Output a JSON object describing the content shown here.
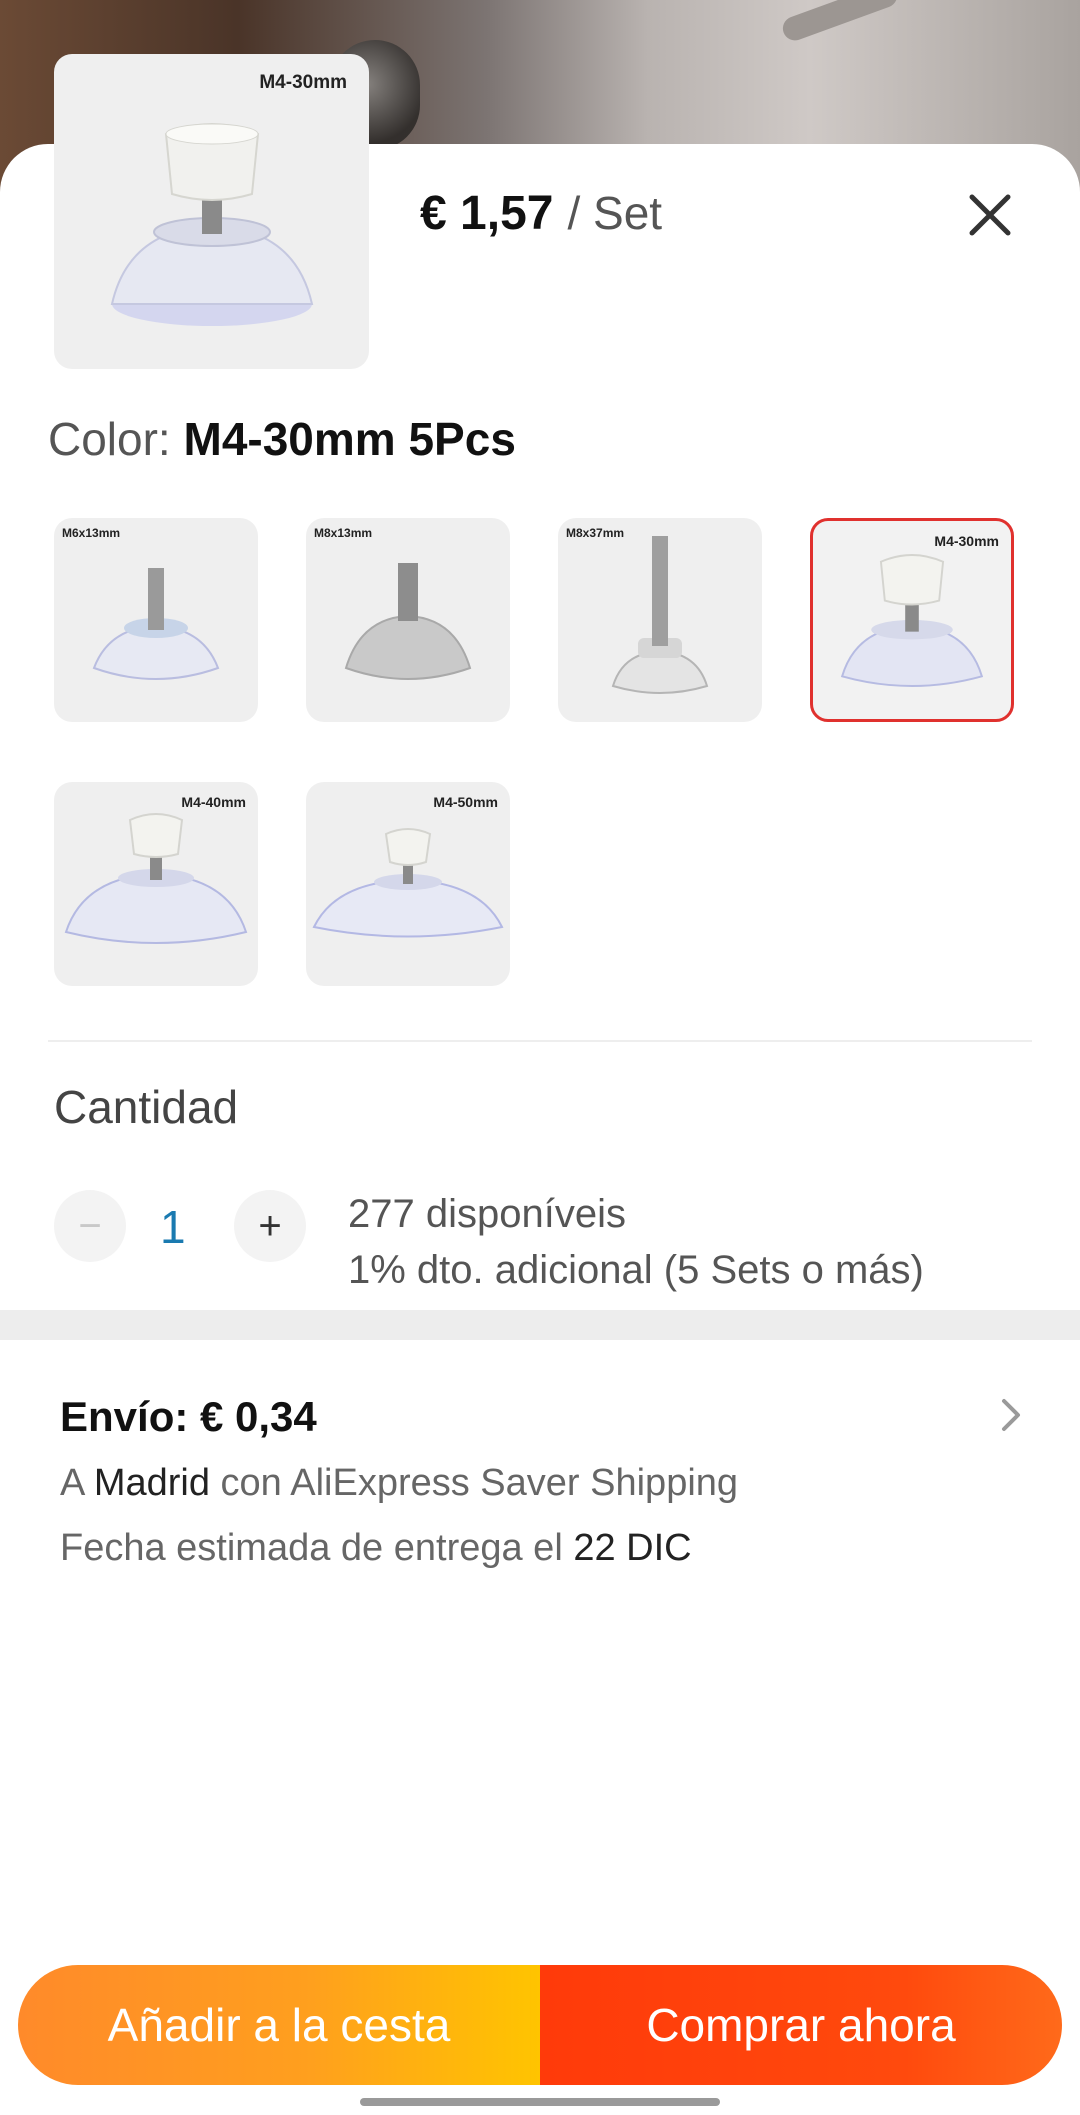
{
  "header": {
    "price": "€ 1,57",
    "unit": "/ Set",
    "thumb_label": "M4-30mm"
  },
  "color": {
    "label": "Color:",
    "selected_value": "M4-30mm 5Pcs",
    "swatches": [
      {
        "tag": "M6x13mm",
        "selected": false
      },
      {
        "tag": "M8x13mm",
        "selected": false
      },
      {
        "tag": "M8x37mm",
        "selected": false
      },
      {
        "tag": "M4-30mm",
        "selected": true
      },
      {
        "tag": "M4-40mm",
        "selected": false
      },
      {
        "tag": "M4-50mm",
        "selected": false
      }
    ]
  },
  "quantity": {
    "title": "Cantidad",
    "minus": "−",
    "value": "1",
    "plus": "+",
    "available": "277 disponíveis",
    "discount": "1% dto. adicional (5 Sets o más)"
  },
  "shipping": {
    "title": "Envío: € 0,34",
    "line1_a": "A ",
    "line1_city": "Madrid",
    "line1_b": " con AliExpress Saver Shipping",
    "line2_a": "Fecha estimada de entrega el ",
    "line2_date": "22 DIC"
  },
  "actions": {
    "add_to_cart": "Añadir a la cesta",
    "buy_now": "Comprar ahora"
  },
  "icons": {
    "close": "close-icon",
    "chevron": "chevron-right-icon"
  },
  "colors": {
    "selected_border": "#e0312e",
    "quantity_value": "#1a7ab0",
    "cart_gradient_start": "#ff8a2a",
    "cart_gradient_end": "#ffc400",
    "buy_color": "#ff4a0d"
  }
}
